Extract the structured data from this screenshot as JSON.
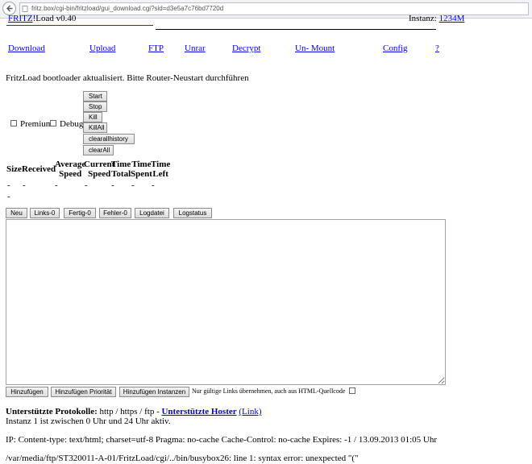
{
  "browser": {
    "url": "fritz.box/cgi-bin/fritzload/gui_download.cgi?sid=d3e5a7c76bd7720d",
    "back_icon": "back-arrow-icon",
    "site_icon": "page-icon"
  },
  "header": {
    "title_link": "FRITZ",
    "title_rest": "!Load v0.40",
    "instance_label": "Instanz:",
    "instance_value": "1234M"
  },
  "nav": {
    "items": [
      "Download",
      "Upload",
      "FTP",
      "Unrar",
      "Decrypt",
      "Un- Mount",
      "Config",
      "?"
    ]
  },
  "status_message": "FritzLoad bootloader aktualisiert. Bitte Router-Neustart durchführen",
  "controls": {
    "premium_label": "Premium",
    "debug_label": "Debug",
    "buttons": [
      "Start",
      "Stop",
      "Kill",
      "KillAll",
      "clearallhistory",
      "clearAll"
    ]
  },
  "table": {
    "headers": [
      [
        "Size"
      ],
      [
        "Received"
      ],
      [
        "Average",
        "Speed"
      ],
      [
        "Current",
        "Speed"
      ],
      [
        "Time",
        "Total"
      ],
      [
        "Time",
        "Spent"
      ],
      [
        "Time",
        "Left"
      ]
    ],
    "row": [
      "-",
      "-",
      "-",
      "-",
      "-",
      "-",
      "-"
    ],
    "second_row": "-"
  },
  "tabs": [
    "Neu",
    "Links-0",
    "Fertig-0",
    "Fehler-0",
    "Logdatei",
    "Logstatus"
  ],
  "links_area": {
    "value": ""
  },
  "bottom_buttons": [
    "Hinzufügen",
    "Hinzufügen Priorität",
    "Hinzufügen Instanzen"
  ],
  "only_valid_label": "Nur gültige Links übernehmen, auch aus HTML-Quellcode",
  "footer": {
    "protocols_label": "Unterstützte Protokolle:",
    "protocols": " http / https / ftp - ",
    "hoster_label": "Unterstützte Hoster",
    "hoster_link": "(Link)",
    "instance_active": "Instanz 1 ist zwischen 0 Uhr und 24 Uhr aktiv.",
    "ip_info": "IP: Content-type: text/html; charset=utf-8 Pragma: no-cache Cache-Control: no-cache Expires: -1  /  13.09.2013 01:05 Uhr",
    "error": "/var/media/ftp/ST320011-A-01/FritzLoad/cgi/../bin/busybox26: line 1: syntax error: unexpected \"(\""
  }
}
